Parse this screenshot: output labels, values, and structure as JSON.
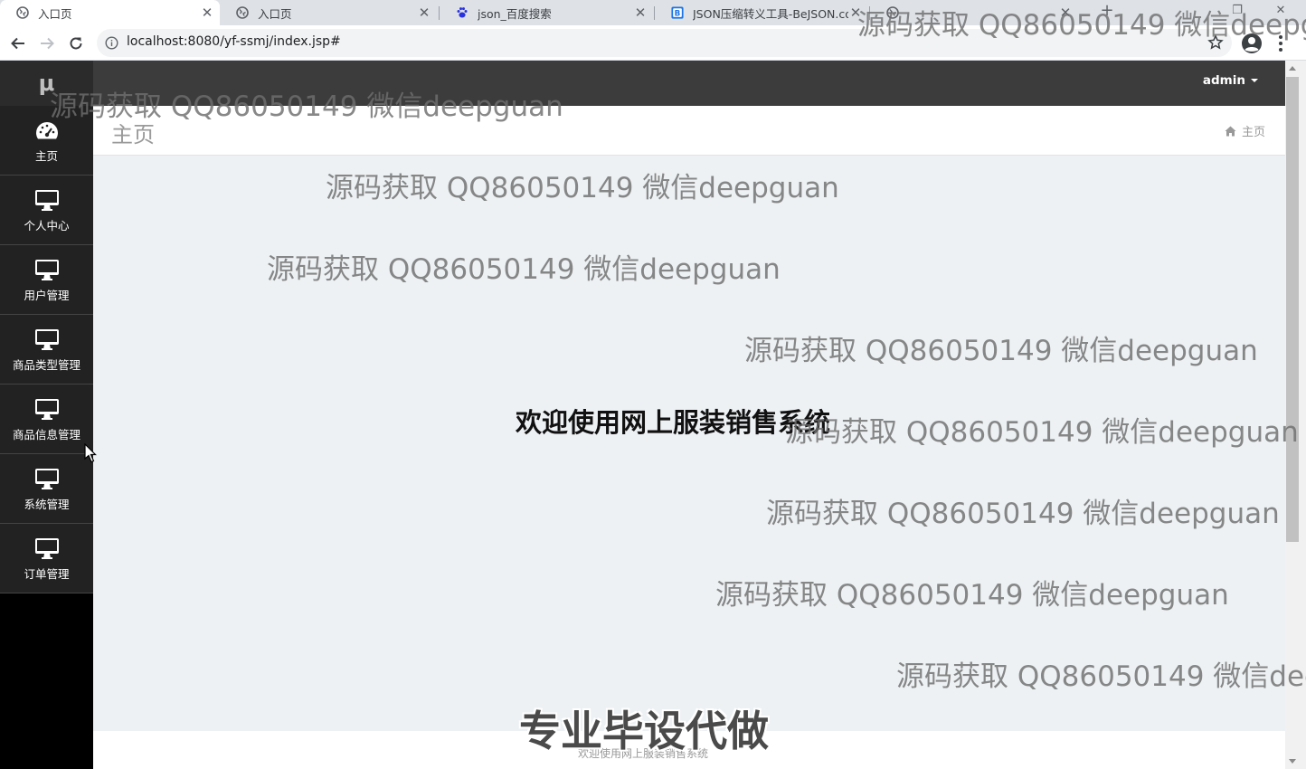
{
  "browser": {
    "tabs": [
      {
        "title": "入口页",
        "active": true,
        "icon": "globe-icon"
      },
      {
        "title": "入口页",
        "active": false,
        "icon": "globe-icon"
      },
      {
        "title": "json_百度搜索",
        "active": false,
        "icon": "baidu-paw-icon"
      },
      {
        "title": "JSON压缩转义工具-BeJSON.co",
        "active": false,
        "icon": "bejson-icon"
      }
    ],
    "url": "localhost:8080/yf-ssmj/index.jsp#"
  },
  "sidebar": {
    "logo": "μ",
    "items": [
      {
        "label": "主页",
        "icon": "dashboard-icon"
      },
      {
        "label": "个人中心",
        "icon": "desktop-icon"
      },
      {
        "label": "用户管理",
        "icon": "desktop-icon"
      },
      {
        "label": "商品类型管理",
        "icon": "desktop-icon"
      },
      {
        "label": "商品信息管理",
        "icon": "desktop-icon"
      },
      {
        "label": "系统管理",
        "icon": "desktop-icon"
      },
      {
        "label": "订单管理",
        "icon": "desktop-icon"
      }
    ]
  },
  "topbar": {
    "user": "admin"
  },
  "page": {
    "title": "主页",
    "breadcrumb": "主页",
    "welcome": "欢迎使用网上服装销售系统",
    "footer": "欢迎使用网上服装销售系统"
  },
  "overlay": {
    "watermark": "源码获取 QQ86050149 微信deepguan",
    "slogan": "专业毕设代做"
  },
  "colors": {
    "sidebar_bg": "#000000",
    "menu_item_bg": "#222222",
    "topbar_bg": "#3c3c3c",
    "content_bg": "#eef1f4"
  }
}
